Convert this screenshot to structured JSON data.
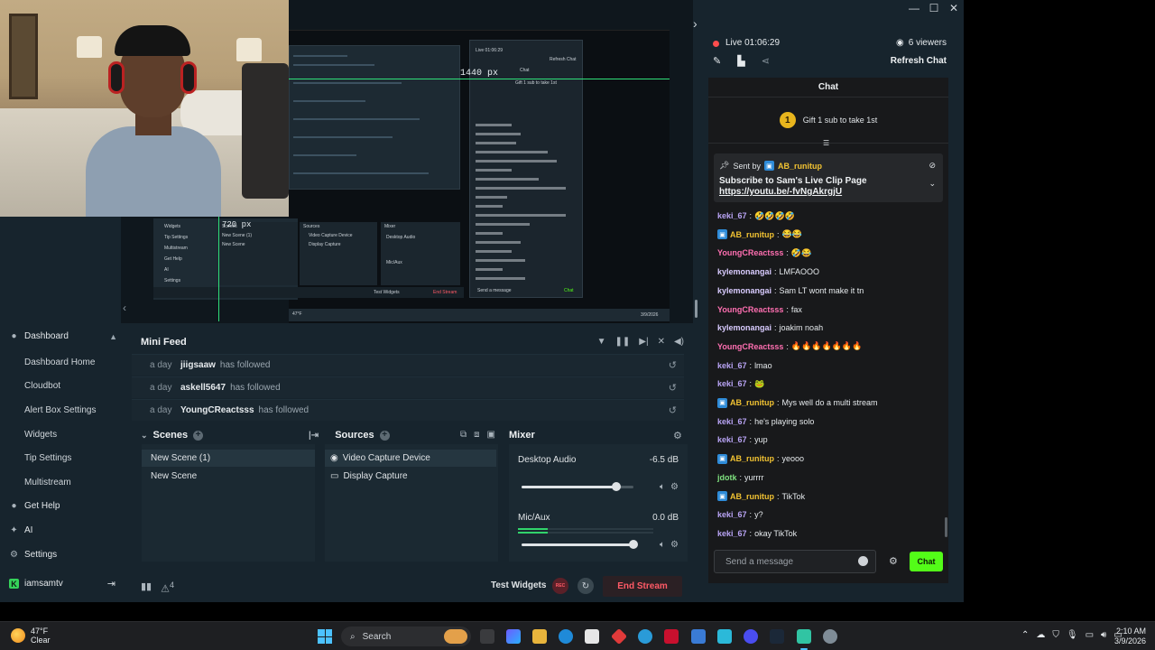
{
  "window": {
    "controls": [
      "—",
      "☐",
      "✕"
    ]
  },
  "preview": {
    "px_label_h": "1440 px",
    "px_label_v": "720 px",
    "mini": {
      "chat_title": "Chat",
      "live_time": "Live 01:06:29",
      "refresh": "Refresh Chat",
      "gift": "Gift 1 sub to take 1st",
      "scenes": "Scenes",
      "sources": "Sources",
      "mixer": "Mixer",
      "desktop_audio": "Desktop Audio",
      "mic_aux": "Mic/Aux",
      "scene1": "New Scene (1)",
      "scene2": "New Scene",
      "src1": "Video Capture Device",
      "src2": "Display Capture",
      "dashboard": "Widgets",
      "tip": "Tip Settings",
      "multistream": "Multistream",
      "help": "Get Help",
      "ai": "AI",
      "settings": "Settings",
      "user": "iamsamtv",
      "test_widgets": "Test Widgets",
      "end_stream": "End Stream",
      "send_msg": "Send a message",
      "chat_btn": "Chat",
      "temp": "47°F",
      "cond": "Clear",
      "date": "3/9/2026"
    }
  },
  "sidebar": {
    "group": {
      "label": "Dashboard",
      "icon": "palette-icon"
    },
    "items": [
      {
        "label": "Dashboard Home"
      },
      {
        "label": "Cloudbot"
      },
      {
        "label": "Alert Box Settings"
      },
      {
        "label": "Widgets"
      },
      {
        "label": "Tip Settings"
      },
      {
        "label": "Multistream"
      }
    ],
    "get_help": "Get Help",
    "ai": "AI",
    "settings": "Settings",
    "user": "iamsamtv"
  },
  "minifeed": {
    "title": "Mini Feed",
    "rows": [
      {
        "time": "a day",
        "user": "jiigsaaw",
        "action": "has followed"
      },
      {
        "time": "a day",
        "user": "askell5647",
        "action": "has followed"
      },
      {
        "time": "a day",
        "user": "YoungCReactsss",
        "action": "has followed"
      }
    ]
  },
  "scenes": {
    "title": "Scenes",
    "items": [
      {
        "label": "New Scene (1)",
        "selected": true
      },
      {
        "label": "New Scene",
        "selected": false
      }
    ]
  },
  "sources": {
    "title": "Sources",
    "items": [
      {
        "label": "Video Capture Device",
        "icon": "camera-icon",
        "selected": true
      },
      {
        "label": "Display Capture",
        "icon": "monitor-icon",
        "selected": false
      }
    ]
  },
  "mixer": {
    "title": "Mixer",
    "channels": [
      {
        "name": "Desktop Audio",
        "db": "-6.5 dB",
        "level": 0.85
      },
      {
        "name": "Mic/Aux",
        "db": "0.0 dB",
        "level": 1.0,
        "meter": 0.22
      }
    ]
  },
  "bottombar": {
    "test_widgets": "Test Widgets",
    "rec": "REC",
    "end_stream": "End Stream",
    "alert_count": "4"
  },
  "stream": {
    "live_label": "Live 01:06:29",
    "viewers": "6 viewers",
    "refresh": "Refresh Chat"
  },
  "chat": {
    "title": "Chat",
    "gift_badge": "1",
    "gift_text": "Gift 1 sub to take 1st",
    "pinned": {
      "sent_by": "Sent by",
      "user": "AB_runitup",
      "message": "Subscribe to Sam's Live Clip Page",
      "link": "https://youtu.be/-fvNgAkrgjU"
    },
    "messages": [
      {
        "user": "keki_67",
        "color": "#b9a4f5",
        "text": "🤣🤣🤣🤣",
        "bot": false
      },
      {
        "user": "AB_runitup",
        "color": "#f1c232",
        "text": "😂😂",
        "bot": true
      },
      {
        "user": "YoungCReactsss",
        "color": "#ff6fb1",
        "text": "🤣😂",
        "bot": false
      },
      {
        "user": "kylemonangai",
        "color": "#d9ccff",
        "text": "LMFAOOO",
        "bot": false
      },
      {
        "user": "kylemonangai",
        "color": "#d9ccff",
        "text": "Sam LT wont make it tn",
        "bot": false
      },
      {
        "user": "YoungCReactsss",
        "color": "#ff6fb1",
        "text": "fax",
        "bot": false
      },
      {
        "user": "kylemonangai",
        "color": "#d9ccff",
        "text": "joakim noah",
        "bot": false
      },
      {
        "user": "YoungCReactsss",
        "color": "#ff6fb1",
        "text": "🔥🔥🔥🔥🔥🔥🔥",
        "bot": false
      },
      {
        "user": "keki_67",
        "color": "#b9a4f5",
        "text": "lmao",
        "bot": false
      },
      {
        "user": "keki_67",
        "color": "#b9a4f5",
        "text": "🐸",
        "bot": false
      },
      {
        "user": "AB_runitup",
        "color": "#f1c232",
        "text": "Mys well do a multi stream",
        "bot": true
      },
      {
        "user": "keki_67",
        "color": "#b9a4f5",
        "text": "he's playing solo",
        "bot": false
      },
      {
        "user": "keki_67",
        "color": "#b9a4f5",
        "text": "yup",
        "bot": false
      },
      {
        "user": "AB_runitup",
        "color": "#f1c232",
        "text": "yeooo",
        "bot": true
      },
      {
        "user": "jdotk",
        "color": "#7ee07e",
        "text": "yurrrr",
        "bot": false
      },
      {
        "user": "AB_runitup",
        "color": "#f1c232",
        "text": "TikTok",
        "bot": true
      },
      {
        "user": "keki_67",
        "color": "#b9a4f5",
        "text": "y?",
        "bot": false
      },
      {
        "user": "keki_67",
        "color": "#b9a4f5",
        "text": "okay TikTok",
        "bot": false
      }
    ],
    "input_placeholder": "Send a message",
    "send_button": "Chat"
  },
  "taskbar": {
    "temp": "47°F",
    "condition": "Clear",
    "search_placeholder": "Search",
    "time": "2:10 AM",
    "date": "3/9/2026"
  },
  "colors": {
    "accent_green": "#53fc18",
    "end_stream_red": "#ff5a66",
    "guide_green": "#2fe07a"
  }
}
